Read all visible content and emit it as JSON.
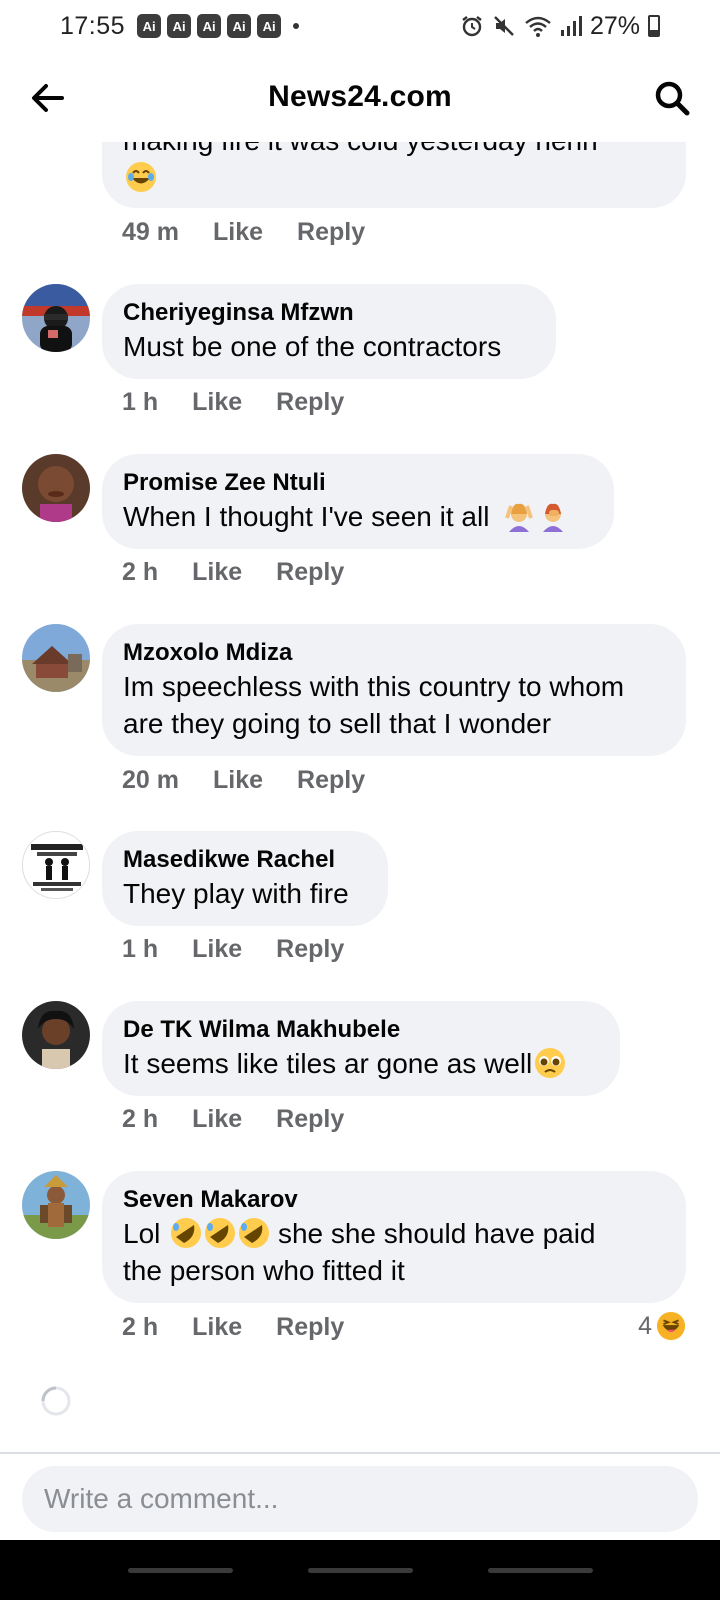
{
  "status_bar": {
    "time": "17:55",
    "badges": [
      "Ai",
      "Ai",
      "Ai",
      "Ai",
      "Ai"
    ],
    "battery": "27%",
    "icons": [
      "alarm-icon",
      "mute-icon",
      "wifi-icon",
      "signal-icon",
      "battery-icon"
    ]
  },
  "header": {
    "title": "News24.com",
    "back_icon": "arrow-left-icon",
    "search_icon": "search-icon"
  },
  "partial_comment": {
    "text_line1": "making fire it was cold yesterday hehh",
    "time": "49 m",
    "like": "Like",
    "reply": "Reply"
  },
  "comments": [
    {
      "author": "Cheriyeginsa Mfzwn",
      "text": "Must be one of the contractors",
      "time": "1 h",
      "like": "Like",
      "reply": "Reply"
    },
    {
      "author": "Promise Zee Ntuli",
      "text": "When I thought I've seen it all",
      "time": "2 h",
      "like": "Like",
      "reply": "Reply"
    },
    {
      "author": "Mzoxolo Mdiza",
      "text_line1": "Im speechless with this country to whom",
      "text_line2": "are they going to sell that I wonder",
      "time": "20 m",
      "like": "Like",
      "reply": "Reply"
    },
    {
      "author": "Masedikwe Rachel",
      "text": "They play with fire",
      "time": "1 h",
      "like": "Like",
      "reply": "Reply"
    },
    {
      "author": "De TK Wilma Makhubele",
      "text": "It seems like tiles ar gone as well",
      "time": "2 h",
      "like": "Like",
      "reply": "Reply"
    },
    {
      "author": "Seven Makarov",
      "text_line1_a": "Lol",
      "text_line1_b": "she she should have paid",
      "text_line2": "the person who fitted it",
      "time": "2 h",
      "like": "Like",
      "reply": "Reply",
      "reaction_count": "4"
    }
  ],
  "composer": {
    "placeholder": "Write a comment..."
  },
  "colors": {
    "bubble": "#f0f2f5",
    "meta_text": "#65676b",
    "primary_text": "#050505"
  }
}
